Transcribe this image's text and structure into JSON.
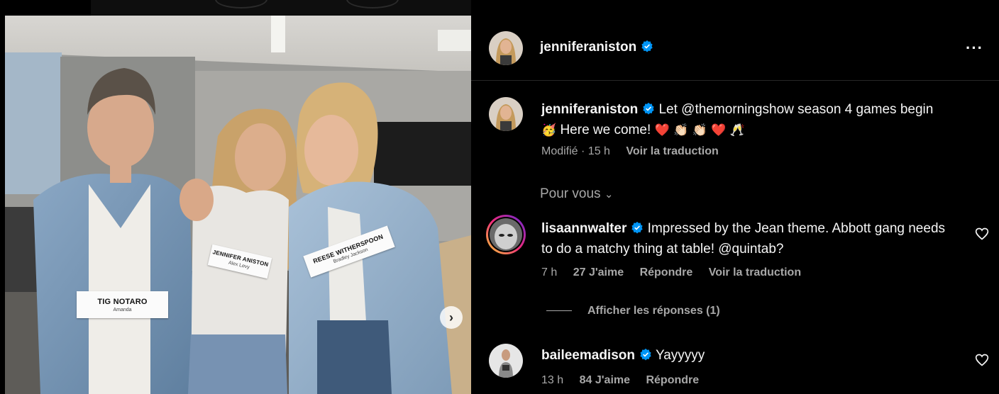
{
  "post": {
    "author": "jenniferaniston",
    "caption_text": "Let @themorningshow season 4 games begin",
    "caption_line2": "Here we come!",
    "caption_emoji_1": "🥳",
    "caption_emoji_2": "❤️ 👏🏻 👏🏻 ❤️ 🥂",
    "edited_label": "Modifié",
    "time": "15 h",
    "translate_label": "Voir la traduction",
    "more_icon": "more-horizontal-icon",
    "verified_color": "#0095f6"
  },
  "photo": {
    "tags": [
      {
        "name": "TIG NOTARO",
        "role": "Amanda"
      },
      {
        "name": "JENNIFER ANISTON",
        "role": "Alex Levy"
      },
      {
        "name": "REESE WITHERSPOON",
        "role": "Bradley Jackson"
      }
    ],
    "next_icon": "chevron-right-icon"
  },
  "section_label": "Pour vous",
  "comments": [
    {
      "user": "lisaannwalter",
      "text": "Impressed by the Jean theme. Abbott gang needs to do a matchy thing at table! @quintab?",
      "time": "7 h",
      "likes": "27 J'aime",
      "reply": "Répondre",
      "translate": "Voir la traduction",
      "view_replies": "Afficher les réponses (1)"
    },
    {
      "user": "baileemadison",
      "text": "Yayyyyy",
      "time": "13 h",
      "likes": "84 J'aime",
      "reply": "Répondre"
    }
  ]
}
